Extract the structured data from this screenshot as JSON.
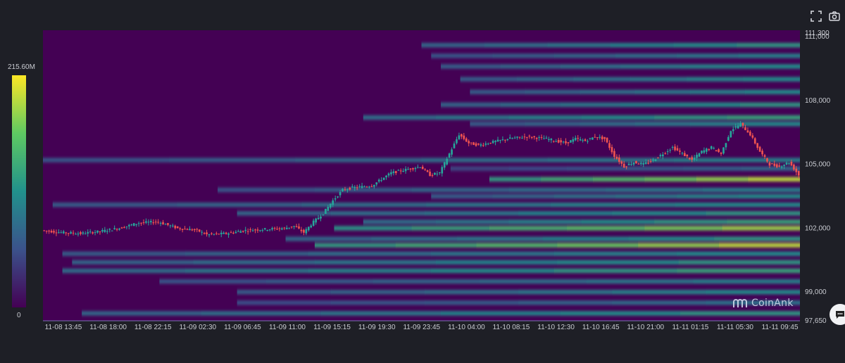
{
  "toolbar": {
    "fullscreen_icon": "fullscreen-icon",
    "screenshot_icon": "camera-icon"
  },
  "watermark": {
    "text": "CoinAnk"
  },
  "chat": {
    "icon": "chat-bubble-icon"
  },
  "colors": {
    "background": "#1e1f26",
    "heatmap_low": "#440154",
    "heatmap_mid": "#21918c",
    "heatmap_high": "#fde725",
    "candle_up": "#26a69a",
    "candle_down": "#ef5350"
  },
  "chart_data": {
    "type": "heatmap",
    "title": "",
    "xlabel": "",
    "ylabel": "",
    "colorbar": {
      "max_label": "215.60M",
      "min_label": "0",
      "range": [
        0,
        215.6
      ]
    },
    "x_ticks": [
      "11-08 13:45",
      "11-08 18:00",
      "11-08 22:15",
      "11-09 02:30",
      "11-09 06:45",
      "11-09 11:00",
      "11-09 15:15",
      "11-09 19:30",
      "11-09 23:45",
      "11-10 04:00",
      "11-10 08:15",
      "11-10 12:30",
      "11-10 16:45",
      "11-10 21:00",
      "11-11 01:15",
      "11-11 05:30",
      "11-11 09:45"
    ],
    "y_ticks": [
      {
        "label": "111,300",
        "value": 111300
      },
      {
        "label": "111,000",
        "value": 111000
      },
      {
        "label": "108,000",
        "value": 108000
      },
      {
        "label": "105,000",
        "value": 105000
      },
      {
        "label": "102,000",
        "value": 102000
      },
      {
        "label": "99,000",
        "value": 99000
      },
      {
        "label": "97,650",
        "value": 97650
      }
    ],
    "ylim": [
      97650,
      111300
    ],
    "x_range_hours": [
      0,
      78
    ],
    "price_path": [
      [
        0,
        101900
      ],
      [
        2,
        101800
      ],
      [
        4,
        101750
      ],
      [
        6,
        101850
      ],
      [
        8,
        102000
      ],
      [
        10,
        102250
      ],
      [
        12,
        102300
      ],
      [
        14,
        102000
      ],
      [
        16,
        101900
      ],
      [
        17,
        101700
      ],
      [
        19,
        101750
      ],
      [
        21,
        101900
      ],
      [
        23,
        101950
      ],
      [
        25,
        102000
      ],
      [
        26,
        102100
      ],
      [
        27,
        101800
      ],
      [
        28,
        102300
      ],
      [
        29,
        102700
      ],
      [
        30,
        103300
      ],
      [
        31,
        103800
      ],
      [
        32,
        103900
      ],
      [
        34,
        104000
      ],
      [
        35,
        104300
      ],
      [
        36,
        104600
      ],
      [
        37,
        104700
      ],
      [
        38,
        104800
      ],
      [
        39,
        104900
      ],
      [
        40,
        104500
      ],
      [
        41,
        104600
      ],
      [
        42,
        105500
      ],
      [
        43,
        106400
      ],
      [
        44,
        106000
      ],
      [
        45,
        105900
      ],
      [
        46,
        106000
      ],
      [
        48,
        106200
      ],
      [
        50,
        106300
      ],
      [
        52,
        106200
      ],
      [
        54,
        106000
      ],
      [
        55,
        106200
      ],
      [
        56,
        106100
      ],
      [
        57,
        106300
      ],
      [
        58,
        106200
      ],
      [
        59,
        105400
      ],
      [
        60,
        104900
      ],
      [
        61,
        105100
      ],
      [
        62,
        105000
      ],
      [
        63,
        105200
      ],
      [
        64,
        105500
      ],
      [
        65,
        105800
      ],
      [
        66,
        105500
      ],
      [
        67,
        105200
      ],
      [
        68,
        105600
      ],
      [
        69,
        105800
      ],
      [
        70,
        105500
      ],
      [
        71,
        106600
      ],
      [
        72,
        106900
      ],
      [
        73,
        106400
      ],
      [
        74,
        105600
      ],
      [
        75,
        105000
      ],
      [
        76,
        104900
      ],
      [
        77,
        105100
      ],
      [
        78,
        104500
      ]
    ],
    "bands": [
      {
        "price": 110600,
        "intensity": 0.55,
        "start_hours": 39
      },
      {
        "price": 110100,
        "intensity": 0.45,
        "start_hours": 40
      },
      {
        "price": 109600,
        "intensity": 0.5,
        "start_hours": 41
      },
      {
        "price": 109000,
        "intensity": 0.5,
        "start_hours": 43
      },
      {
        "price": 108400,
        "intensity": 0.5,
        "start_hours": 44
      },
      {
        "price": 107800,
        "intensity": 0.55,
        "start_hours": 41
      },
      {
        "price": 107200,
        "intensity": 0.6,
        "start_hours": 33
      },
      {
        "price": 106900,
        "intensity": 0.5,
        "start_hours": 44
      },
      {
        "price": 105200,
        "intensity": 0.45,
        "start_hours": 0
      },
      {
        "price": 104800,
        "intensity": 0.35,
        "start_hours": 42
      },
      {
        "price": 104300,
        "intensity": 0.9,
        "start_hours": 46
      },
      {
        "price": 103800,
        "intensity": 0.45,
        "start_hours": 18
      },
      {
        "price": 103500,
        "intensity": 0.5,
        "start_hours": 40
      },
      {
        "price": 103100,
        "intensity": 0.5,
        "start_hours": 1
      },
      {
        "price": 102700,
        "intensity": 0.55,
        "start_hours": 20
      },
      {
        "price": 102300,
        "intensity": 0.6,
        "start_hours": 33
      },
      {
        "price": 102000,
        "intensity": 0.85,
        "start_hours": 30
      },
      {
        "price": 101500,
        "intensity": 0.55,
        "start_hours": 25
      },
      {
        "price": 101200,
        "intensity": 0.9,
        "start_hours": 28
      },
      {
        "price": 100800,
        "intensity": 0.5,
        "start_hours": 2
      },
      {
        "price": 100400,
        "intensity": 0.55,
        "start_hours": 3
      },
      {
        "price": 100000,
        "intensity": 0.6,
        "start_hours": 2
      },
      {
        "price": 99500,
        "intensity": 0.45,
        "start_hours": 12
      },
      {
        "price": 99000,
        "intensity": 0.5,
        "start_hours": 20
      },
      {
        "price": 98500,
        "intensity": 0.4,
        "start_hours": 20
      },
      {
        "price": 98000,
        "intensity": 0.55,
        "start_hours": 4
      }
    ]
  }
}
